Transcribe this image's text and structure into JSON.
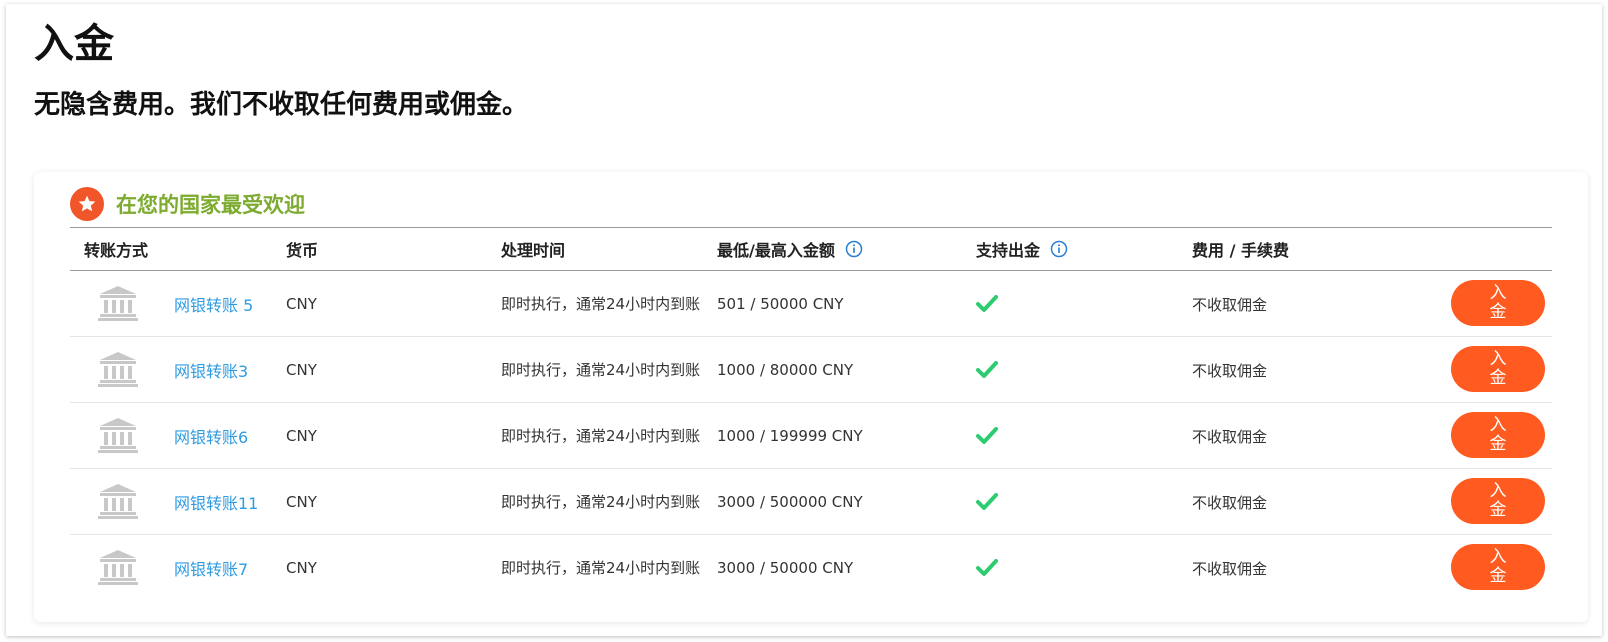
{
  "page": {
    "title": "入金",
    "subtitle": "无隐含费用。我们不收取任何费用或佣金。"
  },
  "section": {
    "title": "在您的国家最受欢迎",
    "icon": "star-badge-icon"
  },
  "table": {
    "headers": {
      "method": "转账方式",
      "currency": "货币",
      "time": "处理时间",
      "limits": "最低/最高入金额",
      "withdrawal": "支持出金",
      "fee": "费用 / 手续费"
    },
    "rows": [
      {
        "method": "网银转账 5",
        "currency": "CNY",
        "time": "即时执行，通常24小时内到账",
        "limits": "501 / 50000 CNY",
        "withdrawal": "check-icon",
        "fee": "不收取佣金",
        "button": "入金"
      },
      {
        "method": "网银转账3",
        "currency": "CNY",
        "time": "即时执行，通常24小时内到账",
        "limits": "1000 / 80000 CNY",
        "withdrawal": "check-icon",
        "fee": "不收取佣金",
        "button": "入金"
      },
      {
        "method": "网银转账6",
        "currency": "CNY",
        "time": "即时执行，通常24小时内到账",
        "limits": "1000 / 199999 CNY",
        "withdrawal": "check-icon",
        "fee": "不收取佣金",
        "button": "入金"
      },
      {
        "method": "网银转账11",
        "currency": "CNY",
        "time": "即时执行，通常24小时内到账",
        "limits": "3000 / 500000 CNY",
        "withdrawal": "check-icon",
        "fee": "不收取佣金",
        "button": "入金"
      },
      {
        "method": "网银转账7",
        "currency": "CNY",
        "time": "即时执行，通常24小时内到账",
        "limits": "3000 / 50000 CNY",
        "withdrawal": "check-icon",
        "fee": "不收取佣金",
        "button": "入金"
      }
    ]
  },
  "colors": {
    "accent_orange": "#ff5a1f",
    "section_green": "#7cab2f",
    "link_blue": "#2f9be0",
    "check_green": "#2ecc71",
    "info_blue": "#2a7fd4"
  }
}
